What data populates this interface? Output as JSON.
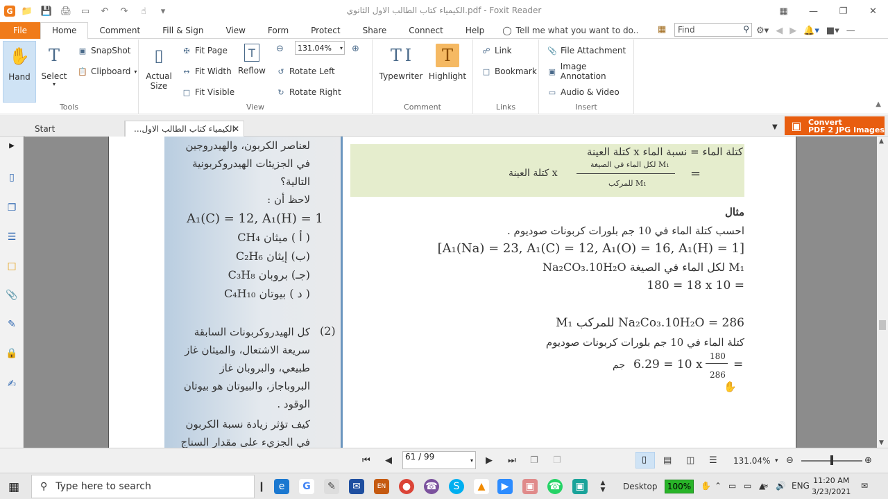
{
  "window": {
    "title": "الكيمياء كتاب الطالب الاول الثانوي.pdf - Foxit Reader",
    "app_logo": "G"
  },
  "ribbon_tabs": {
    "file": "File",
    "home": "Home",
    "comment": "Comment",
    "fill_sign": "Fill & Sign",
    "view": "View",
    "form": "Form",
    "protect": "Protect",
    "share": "Share",
    "connect": "Connect",
    "help": "Help",
    "tell_me": "Tell me what you want to do..",
    "find_placeholder": "Find"
  },
  "ribbon": {
    "tools": {
      "label": "Tools",
      "hand": "Hand",
      "select": "Select",
      "snapshot": "SnapShot",
      "clipboard": "Clipboard"
    },
    "view": {
      "label": "View",
      "actual_size_1": "Actual",
      "actual_size_2": "Size",
      "fit_page": "Fit Page",
      "fit_width": "Fit Width",
      "fit_visible": "Fit Visible",
      "reflow": "Reflow",
      "zoom_value": "131.04%",
      "rotate_left": "Rotate Left",
      "rotate_right": "Rotate Right"
    },
    "comment": {
      "label": "Comment",
      "typewriter": "Typewriter",
      "highlight": "Highlight"
    },
    "links": {
      "label": "Links",
      "link": "Link",
      "bookmark": "Bookmark"
    },
    "insert": {
      "label": "Insert",
      "file_attachment": "File Attachment",
      "image_annotation": "Image Annotation",
      "audio_video": "Audio & Video"
    }
  },
  "doc_tabs": {
    "start": "Start",
    "current": "...الكيمياء كتاب الطالب الاول"
  },
  "convert": {
    "line1": "Convert",
    "line2": "PDF 2 JPG Images"
  },
  "page_content": {
    "left_column": [
      "لعناصر الكربون، والهيدروجين",
      "في الجزيئات الهيدروكربونية",
      "التالية؟",
      "لاحظ أن :",
      "A₁(C) = 12, A₁(H) = 1",
      "( أ )  ميثان  CH₄",
      "(ب)  إيثان  C₂H₆",
      "(جـ)  بروبان  C₃H₈",
      "( د )  بيوتان  C₄H₁₀",
      "(2)",
      "كل الهيدروكربونات السابقة",
      "سريعة الاشتعال، والميثان غاز",
      "طبيعي، والبروبان غاز",
      "البروباجاز، والبيوتان هو بيوتان",
      "الوقود .",
      "كيف تؤثر زيادة نسبة الكربون",
      "في الجزيء على مقدار السناج"
    ],
    "formula_box": {
      "line1": "كتلة الماء = نسبة الماء x كتلة العينة",
      "numerator": "M₁ لكل الماء في الصيغة",
      "denominator": "M₁ للمركب",
      "times_sample": "x كتلة العينة",
      "equals": "="
    },
    "example": {
      "heading": "مثال",
      "question": "احسب كتلة الماء في 10 جم بلورات كربونات صوديوم .",
      "masses": "[A₁(Na) = 23, A₁(C) = 12, A₁(O) = 16, A₁(H) = 1]",
      "water_mass_label": "M₁ لكل الماء في الصيغة Na₂CO₃.10H₂O",
      "water_mass_value": "180 = 18 x 10 =",
      "compound_mass": "286 = Na₂Co₃.10H₂O للمركب M₁",
      "water_in_sample": "كتلة الماء في 10 جم بلورات كربونات صوديوم",
      "frac_num": "180",
      "frac_den": "286",
      "result": "6.29 = 10 x",
      "result_unit": "جم",
      "result_eq": "="
    }
  },
  "status": {
    "page_indicator": "61 / 99",
    "zoom": "131.04%"
  },
  "taskbar": {
    "search_placeholder": "Type here to search",
    "desktop_label": "Desktop",
    "battery": "100%",
    "language": "ENG",
    "time": "11:20 AM",
    "date": "3/23/2021"
  }
}
